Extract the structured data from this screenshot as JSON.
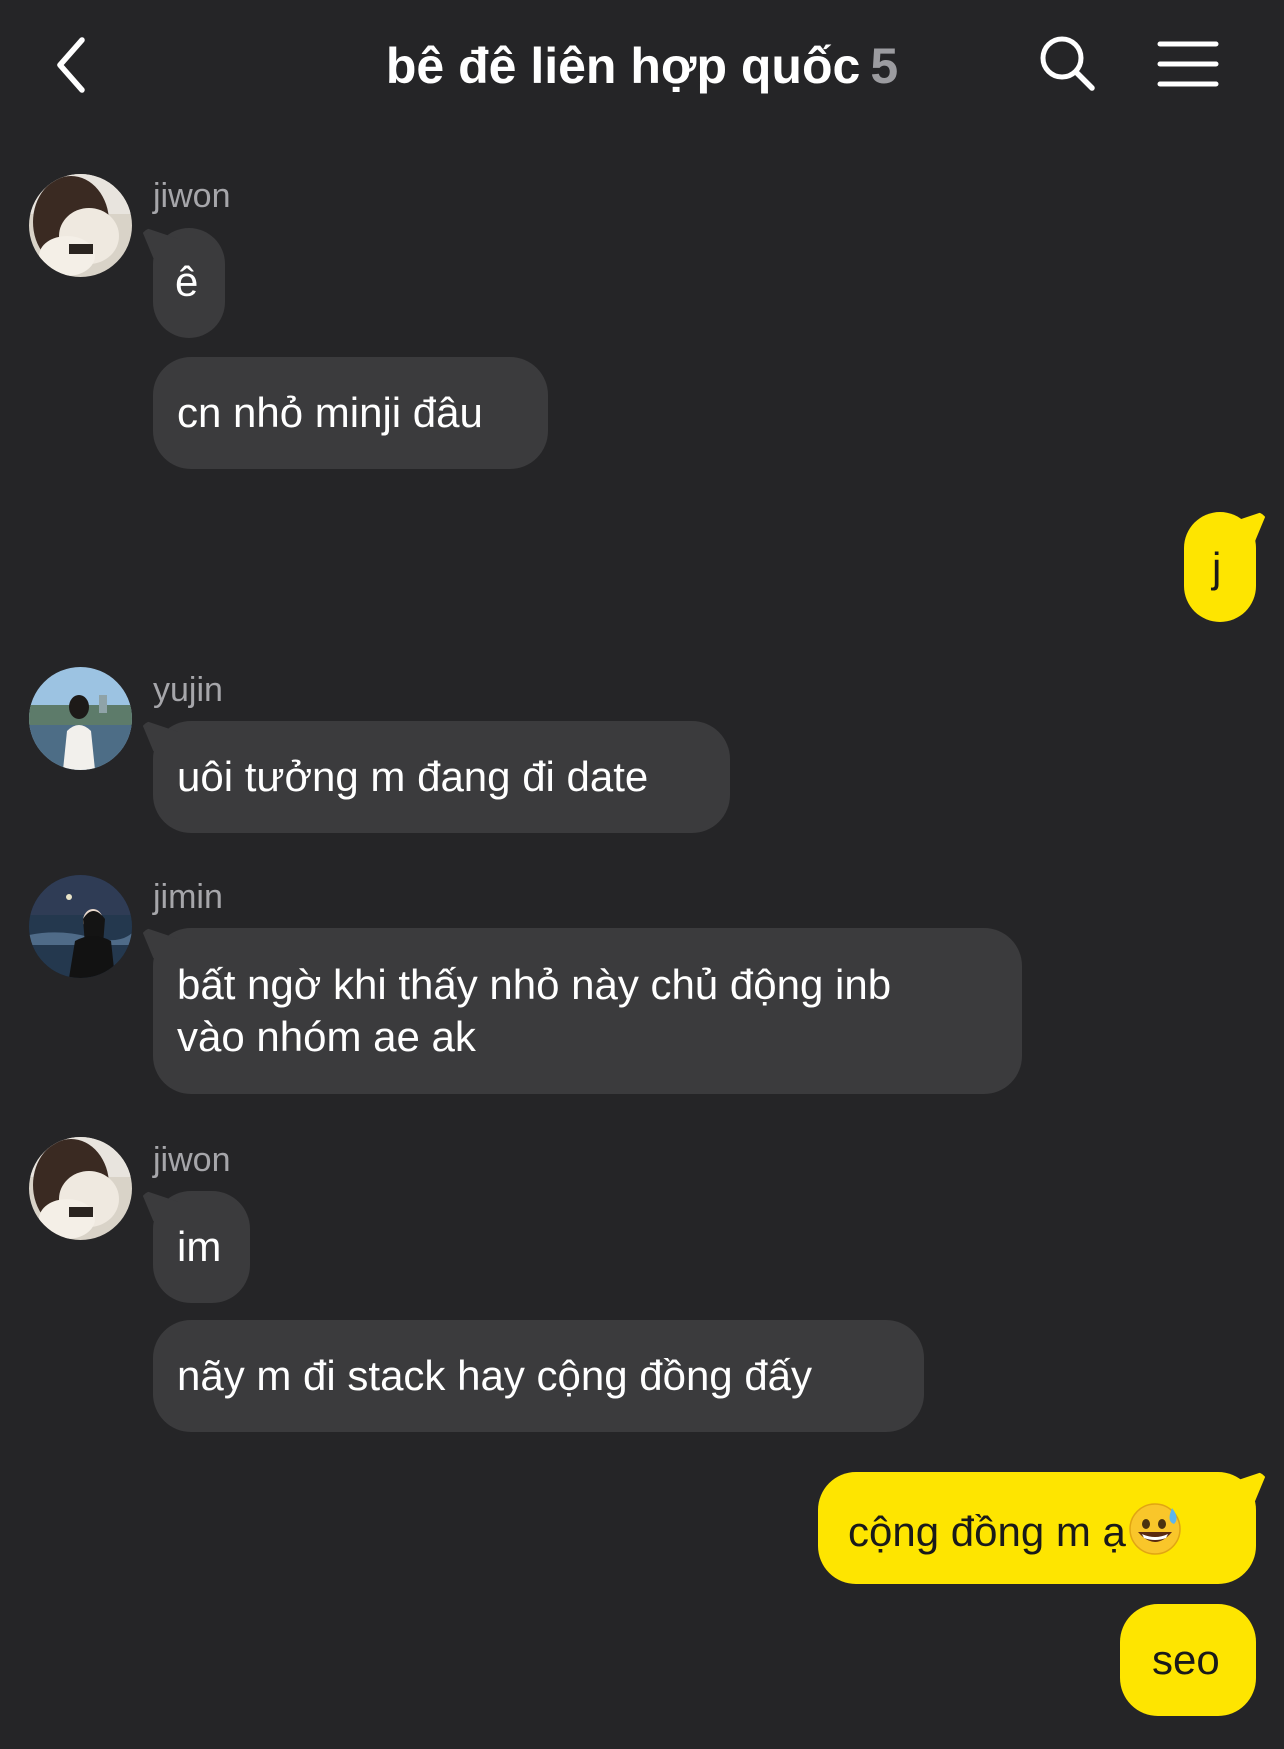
{
  "header": {
    "title": "bê đê liên hợp quốc",
    "member_count": "5"
  },
  "messages": [
    {
      "sender": "jiwon",
      "text": "ê"
    },
    {
      "text": "cn nhỏ minji đâu"
    },
    {
      "self": true,
      "text": "j"
    },
    {
      "sender": "yujin",
      "text": "uôi tưởng m đang đi date"
    },
    {
      "sender": "jimin",
      "lines": [
        "bất ngờ khi thấy nhỏ này chủ động inb",
        "vào nhóm ae ak"
      ]
    },
    {
      "sender": "jiwon",
      "text": "im"
    },
    {
      "text": "nãy m đi stack hay cộng đồng đấy"
    },
    {
      "self": true,
      "text": "cộng đồng m ạ",
      "emoji": "grinning-sweat-emoji"
    },
    {
      "self": true,
      "text": "seo"
    }
  ],
  "colors": {
    "background": "#252527",
    "incoming_bubble": "#3b3b3d",
    "outgoing_bubble": "#fee500",
    "sender_name": "#a6a6aa"
  }
}
